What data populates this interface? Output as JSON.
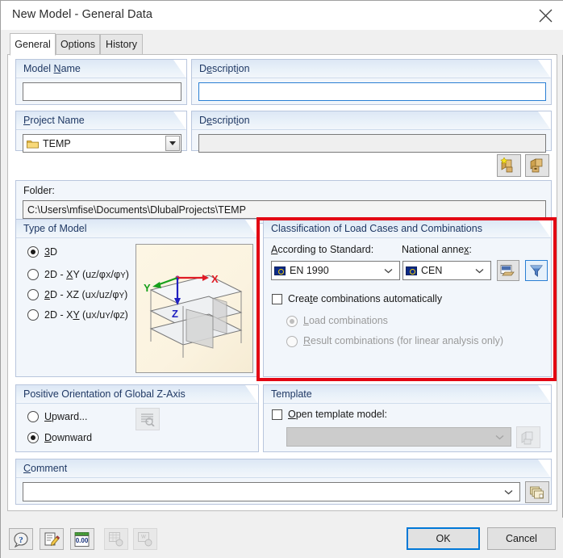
{
  "window": {
    "title": "New Model - General Data",
    "close_icon": "close-icon"
  },
  "tabs": [
    {
      "label": "General",
      "active": true
    },
    {
      "label": "Options",
      "active": false
    },
    {
      "label": "History",
      "active": false
    }
  ],
  "model_name_group": {
    "title": "Model Name",
    "value": "",
    "placeholder": ""
  },
  "model_description_group": {
    "title": "Description",
    "value": "",
    "placeholder": ""
  },
  "project_name_group": {
    "title": "Project Name",
    "value": "TEMP",
    "icon": "folder-icon",
    "folder_label": "Folder:",
    "folder_path": "C:\\Users\\mfise\\Documents\\DlubalProjects\\TEMP",
    "new_project_icon": "new-project-box-icon",
    "open_project_icon": "open-project-box-icon"
  },
  "project_description_group": {
    "title": "Description",
    "value": "",
    "placeholder": ""
  },
  "type_of_model": {
    "title": "Type of Model",
    "options": [
      {
        "label": "3D",
        "mnemonic": "3",
        "selected": true
      },
      {
        "label": "2D - XY (uZ/φX/φY)",
        "selected": false
      },
      {
        "label": "2D - XZ (uX/uZ/φY)",
        "selected": false
      },
      {
        "label": "2D - XY (uX/uY/φZ)",
        "selected": false
      }
    ],
    "preview_axes": {
      "x": "X",
      "y": "Y",
      "z": "Z"
    },
    "preview_colors": {
      "x": "#e01b24",
      "y": "#17a01c",
      "z": "#2020c0"
    }
  },
  "classification": {
    "title": "Classification of Load Cases and Combinations",
    "standard_label": "According to Standard:",
    "standard_value": "EN 1990",
    "annex_label": "National annex:",
    "annex_value": "CEN",
    "edit_standard_icon": "edit-standard-icon",
    "filter_icon": "filter-funnel-icon",
    "create_auto": {
      "label": "Create combinations automatically",
      "checked": false
    },
    "sub_options": [
      {
        "label": "Load combinations",
        "selected": true,
        "disabled": true
      },
      {
        "label": "Result combinations (for linear analysis only)",
        "selected": false,
        "disabled": true
      }
    ],
    "highlight_color": "#e30613"
  },
  "z_axis": {
    "title": "Positive Orientation of Global Z-Axis",
    "options": [
      {
        "label": "Upward...",
        "selected": false
      },
      {
        "label": "Downward",
        "selected": true
      }
    ],
    "preview_icon": "list-preview-icon"
  },
  "template": {
    "title": "Template",
    "checkbox_label": "Open template model:",
    "checked": false,
    "combo_value": "",
    "browse_icon": "browse-model-icon"
  },
  "comment": {
    "title": "Comment",
    "value": "",
    "placeholder": "",
    "button_icon": "comment-library-icon"
  },
  "footer": {
    "tools": [
      {
        "name": "help-icon",
        "disabled": false
      },
      {
        "name": "edit-note-icon",
        "disabled": false
      },
      {
        "name": "units-icon",
        "disabled": false,
        "text": "0.00"
      },
      {
        "name": "export-excel-icon",
        "disabled": true
      },
      {
        "name": "export-word-icon",
        "disabled": true
      }
    ],
    "ok_label": "OK",
    "cancel_label": "Cancel"
  }
}
